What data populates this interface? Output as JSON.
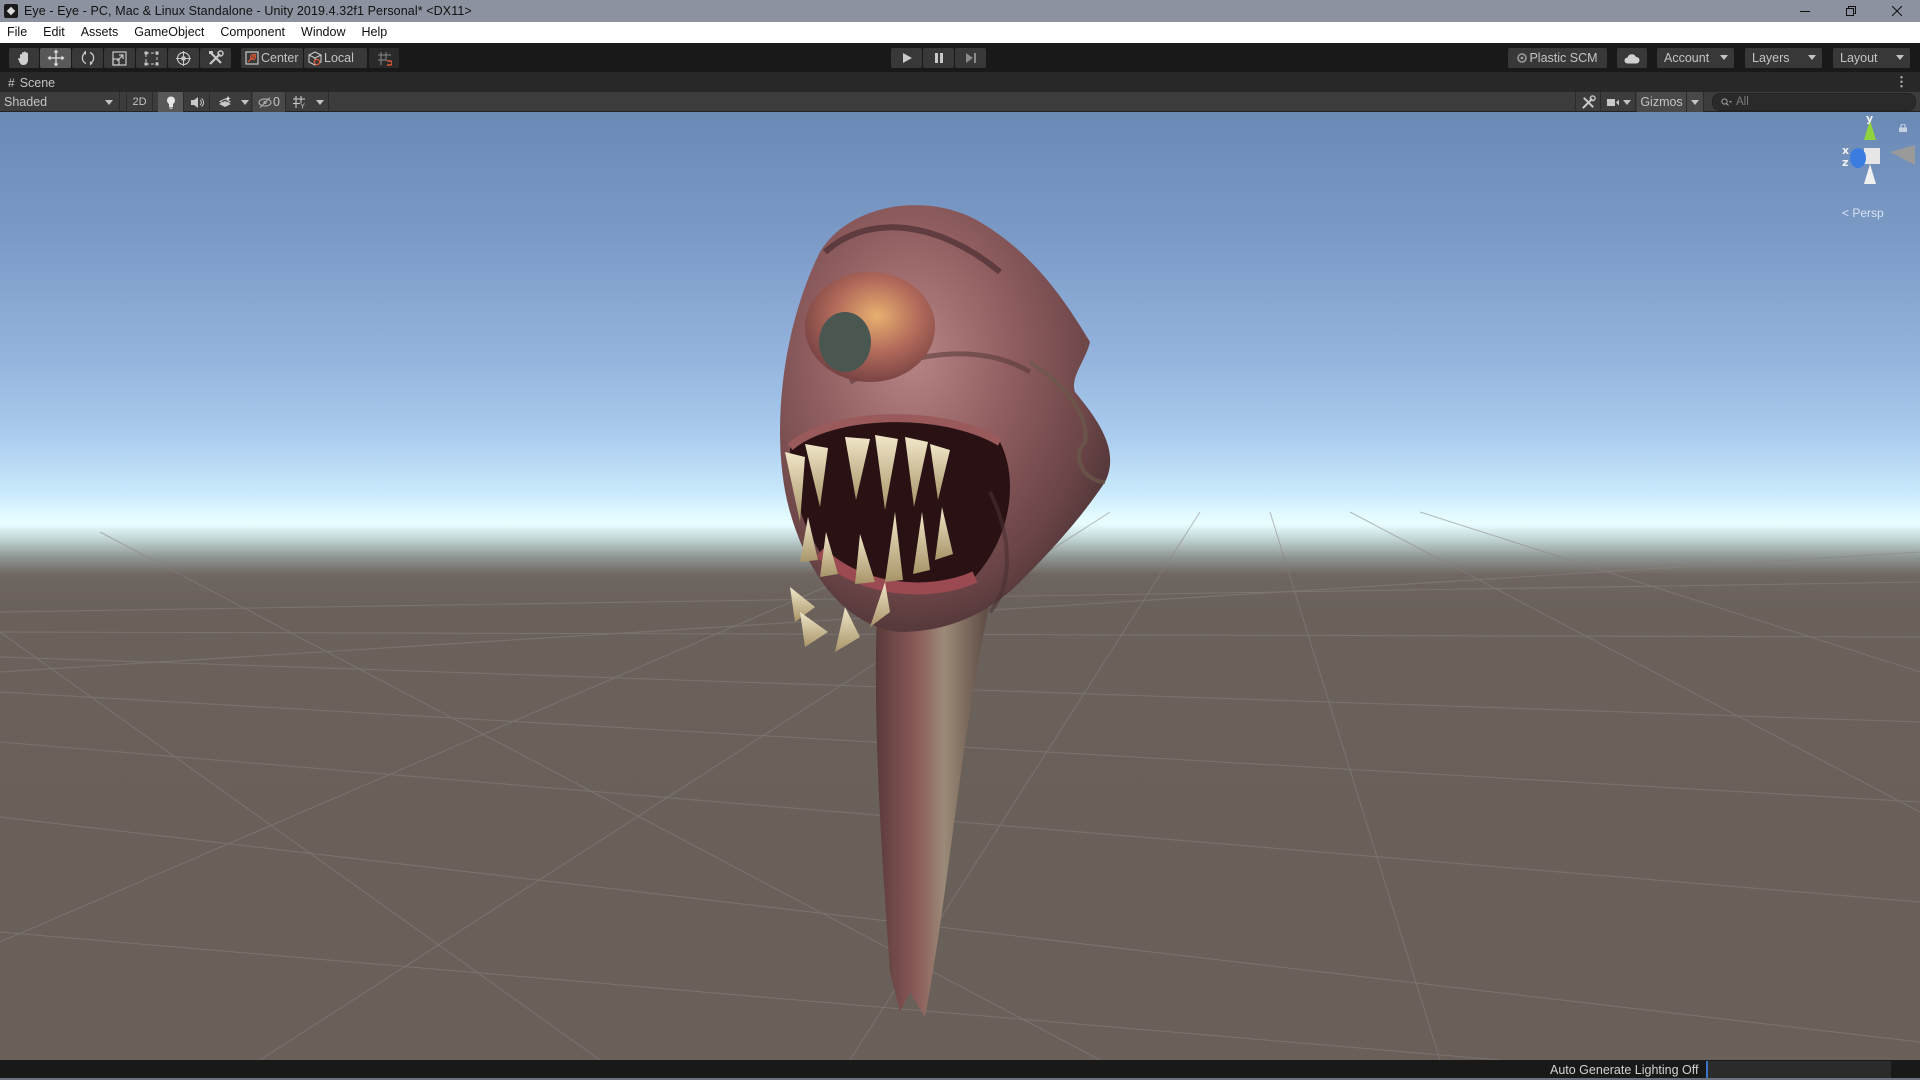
{
  "window": {
    "title": "Eye - Eye - PC, Mac & Linux Standalone - Unity 2019.4.32f1 Personal* <DX11>",
    "controls": [
      "minimize",
      "restore",
      "close"
    ]
  },
  "menu": {
    "items": [
      "File",
      "Edit",
      "Assets",
      "GameObject",
      "Component",
      "Window",
      "Help"
    ]
  },
  "toolbar": {
    "tools": [
      {
        "name": "hand-tool",
        "icon": "hand-icon",
        "active": false
      },
      {
        "name": "move-tool",
        "icon": "move-icon",
        "active": true
      },
      {
        "name": "rotate-tool",
        "icon": "rotate-icon",
        "active": false
      },
      {
        "name": "scale-tool",
        "icon": "scale-icon",
        "active": false
      },
      {
        "name": "rect-tool",
        "icon": "rect-icon",
        "active": false
      },
      {
        "name": "transform-tool",
        "icon": "transform-icon",
        "active": false
      },
      {
        "name": "custom-tool",
        "icon": "tools-icon",
        "active": false
      }
    ],
    "pivot_mode": "Center",
    "pivot_rotation": "Local",
    "playback": {
      "play": "play-icon",
      "pause": "pause-icon",
      "step": "step-icon"
    },
    "plastic_scm": "Plastic SCM",
    "account": "Account",
    "layers": "Layers",
    "layout": "Layout"
  },
  "scene": {
    "tab_label": "Scene",
    "draw_mode": "Shaded",
    "mode_2d": "2D",
    "hidden_count": "0",
    "gizmos": "Gizmos",
    "search_placeholder": "All",
    "projection": "Persp",
    "axes": {
      "y": "y",
      "x": "x",
      "z": "z"
    },
    "object": "Eye (one-eyed creature model)"
  },
  "colors": {
    "accent": "#3a73c4",
    "sky_top": "#6a89b4",
    "horizon": "#e6fcff",
    "ground": "#6a605a",
    "axis_x": "#d83a2e",
    "axis_y": "#8ed43a",
    "axis_z": "#3a7ce0"
  },
  "status": {
    "lighting": "Auto Generate Lighting Off"
  }
}
